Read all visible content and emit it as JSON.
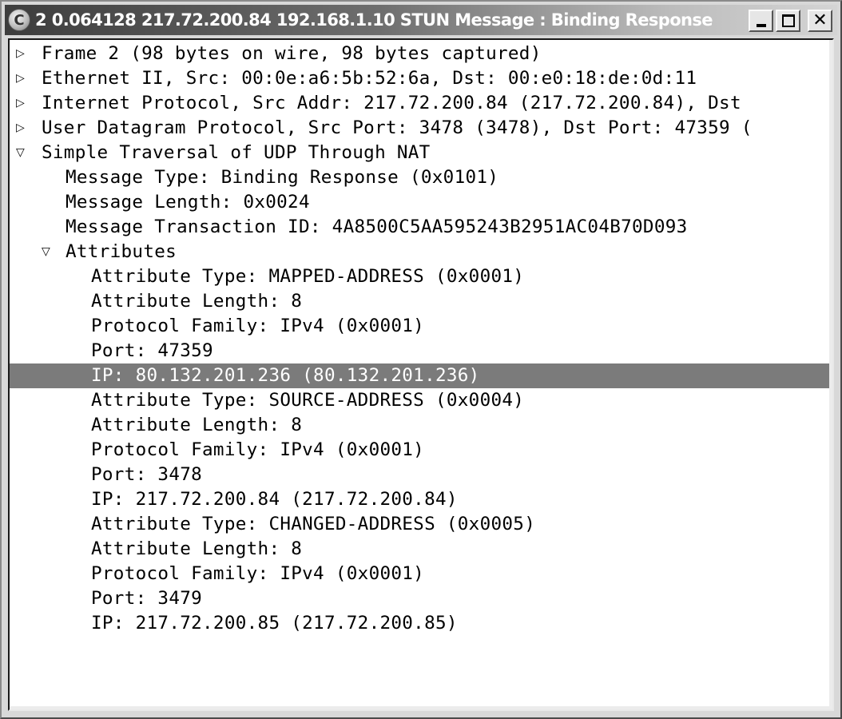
{
  "window": {
    "title": "2 0.064128 217.72.200.84 192.168.1.10 STUN Message : Binding Response",
    "app_icon": "wireshark-c-icon",
    "controls": {
      "minimize": "minimize-icon",
      "maximize": "maximize-icon",
      "close": "close-icon"
    }
  },
  "tree": {
    "expander_icons": {
      "collapsed": "▷",
      "expanded": "▽"
    },
    "rows": [
      {
        "level": 0,
        "state": "collapsed",
        "text": "Frame 2 (98 bytes on wire, 98 bytes captured)"
      },
      {
        "level": 0,
        "state": "collapsed",
        "text": "Ethernet II, Src: 00:0e:a6:5b:52:6a, Dst: 00:e0:18:de:0d:11"
      },
      {
        "level": 0,
        "state": "collapsed",
        "text": "Internet Protocol, Src Addr: 217.72.200.84 (217.72.200.84), Dst"
      },
      {
        "level": 0,
        "state": "collapsed",
        "text": "User Datagram Protocol, Src Port: 3478 (3478), Dst Port: 47359 ("
      },
      {
        "level": 0,
        "state": "expanded",
        "text": "Simple Traversal of UDP Through NAT"
      },
      {
        "level": 1,
        "state": "leaf",
        "text": "Message Type: Binding Response (0x0101)"
      },
      {
        "level": 1,
        "state": "leaf",
        "text": "Message Length: 0x0024"
      },
      {
        "level": 1,
        "state": "leaf",
        "text": "Message Transaction ID: 4A8500C5AA595243B2951AC04B70D093"
      },
      {
        "level": 1,
        "state": "expanded",
        "text": "Attributes"
      },
      {
        "level": 2,
        "state": "leaf",
        "text": "Attribute Type: MAPPED-ADDRESS (0x0001)"
      },
      {
        "level": 2,
        "state": "leaf",
        "text": "Attribute Length: 8"
      },
      {
        "level": 2,
        "state": "leaf",
        "text": "Protocol Family: IPv4 (0x0001)"
      },
      {
        "level": 2,
        "state": "leaf",
        "text": "Port: 47359"
      },
      {
        "level": 2,
        "state": "leaf",
        "text": "IP: 80.132.201.236 (80.132.201.236)",
        "selected": true
      },
      {
        "level": 2,
        "state": "leaf",
        "text": "Attribute Type: SOURCE-ADDRESS (0x0004)"
      },
      {
        "level": 2,
        "state": "leaf",
        "text": "Attribute Length: 8"
      },
      {
        "level": 2,
        "state": "leaf",
        "text": "Protocol Family: IPv4 (0x0001)"
      },
      {
        "level": 2,
        "state": "leaf",
        "text": "Port: 3478"
      },
      {
        "level": 2,
        "state": "leaf",
        "text": "IP: 217.72.200.84 (217.72.200.84)"
      },
      {
        "level": 2,
        "state": "leaf",
        "text": "Attribute Type: CHANGED-ADDRESS (0x0005)"
      },
      {
        "level": 2,
        "state": "leaf",
        "text": "Attribute Length: 8"
      },
      {
        "level": 2,
        "state": "leaf",
        "text": "Protocol Family: IPv4 (0x0001)"
      },
      {
        "level": 2,
        "state": "leaf",
        "text": "Port: 3479"
      },
      {
        "level": 2,
        "state": "leaf",
        "text": "IP: 217.72.200.85 (217.72.200.85)"
      }
    ]
  },
  "colors": {
    "selection_bg": "#7b7b7b",
    "selection_fg": "#ffffff"
  }
}
